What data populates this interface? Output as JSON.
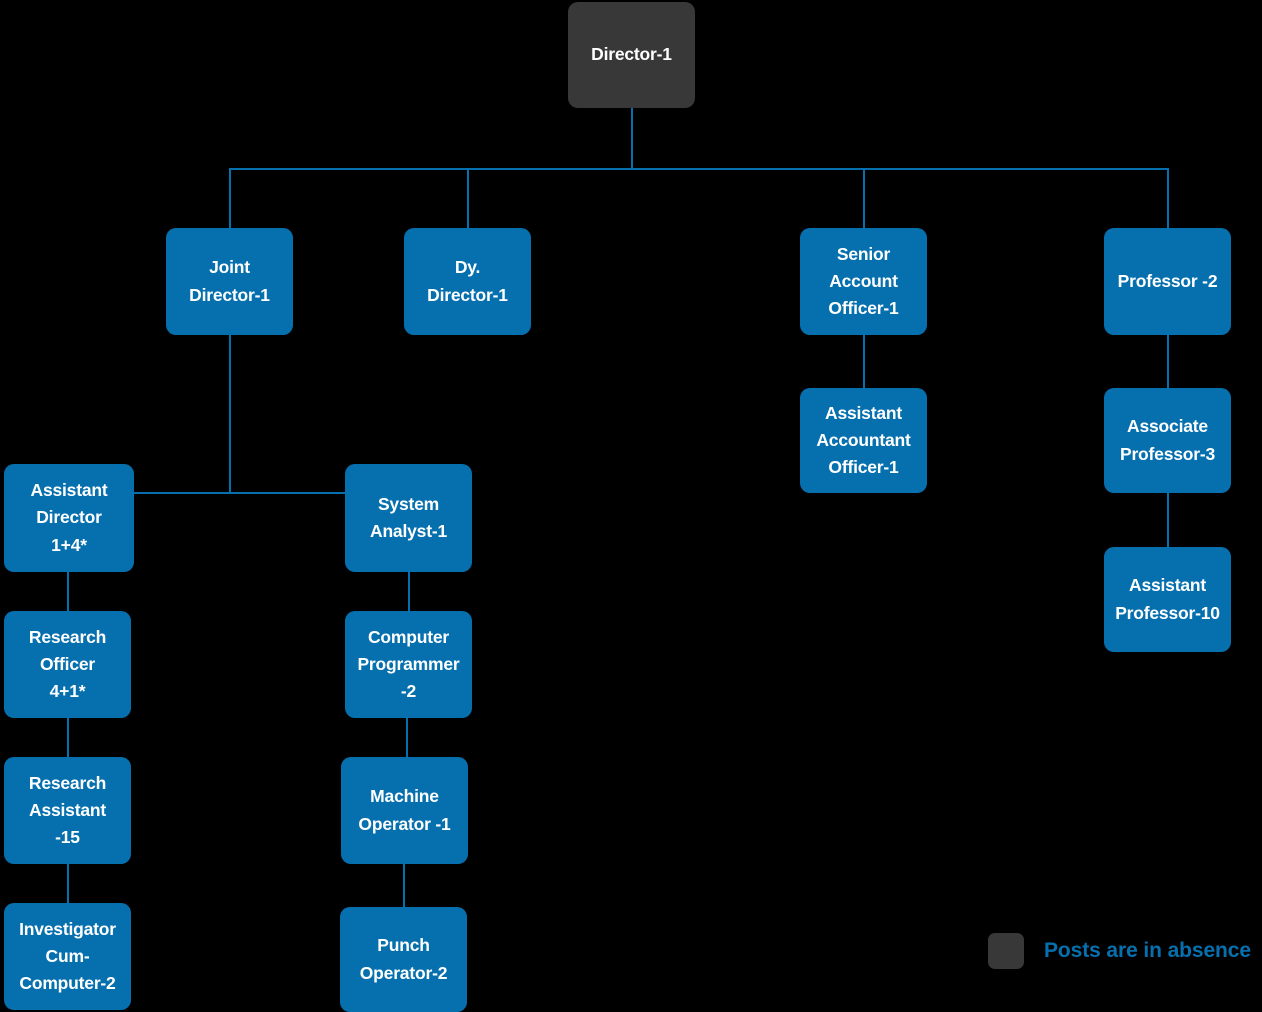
{
  "chart_data": {
    "type": "diagram",
    "title": "Organizational Structure Chart",
    "diagram_kind": "org-chart",
    "colors": {
      "background": "#000000",
      "node_fill": "#0670AF",
      "absent_node_fill": "#383838",
      "node_text": "#ffffff",
      "connector": "#0670AF",
      "legend_text": "#0670AF"
    },
    "nodes": [
      {
        "id": "director",
        "label": "Director-1",
        "count": 1,
        "style": "absent",
        "parent": null,
        "level": 0
      },
      {
        "id": "joint-director",
        "label": "Joint\nDirector-1",
        "count": 1,
        "style": "normal",
        "parent": "director",
        "level": 1
      },
      {
        "id": "dy-director",
        "label": "Dy.\nDirector-1",
        "count": 1,
        "style": "normal",
        "parent": "director",
        "level": 1
      },
      {
        "id": "senior-account-officer",
        "label": "Senior\nAccount\nOfficer-1",
        "count": 1,
        "style": "normal",
        "parent": "director",
        "level": 1
      },
      {
        "id": "professor",
        "label": "Professor -2",
        "count": 2,
        "style": "normal",
        "parent": "director",
        "level": 1
      },
      {
        "id": "assistant-accountant-officer",
        "label": "Assistant\nAccountant\nOfficer-1",
        "count": 1,
        "style": "normal",
        "parent": "senior-account-officer",
        "level": 2
      },
      {
        "id": "associate-professor",
        "label": "Associate\nProfessor-3",
        "count": 3,
        "style": "normal",
        "parent": "professor",
        "level": 2
      },
      {
        "id": "assistant-professor",
        "label": "Assistant\nProfessor-10",
        "count": 10,
        "style": "normal",
        "parent": "associate-professor",
        "level": 3
      },
      {
        "id": "assistant-director",
        "label": "Assistant\nDirector\n1+4*",
        "count": "1+4*",
        "style": "normal",
        "parent": "joint-director",
        "level": 2
      },
      {
        "id": "system-analyst",
        "label": "System\nAnalyst-1",
        "count": 1,
        "style": "normal",
        "parent": "joint-director",
        "level": 2
      },
      {
        "id": "research-officer",
        "label": "Research\nOfficer\n4+1*",
        "count": "4+1*",
        "style": "normal",
        "parent": "assistant-director",
        "level": 3
      },
      {
        "id": "research-assistant",
        "label": "Research\nAssistant\n-15",
        "count": 15,
        "style": "normal",
        "parent": "research-officer",
        "level": 4
      },
      {
        "id": "investigator-cum-computer",
        "label": "Investigator\nCum-\nComputer-2",
        "count": 2,
        "style": "normal",
        "parent": "research-assistant",
        "level": 5
      },
      {
        "id": "computer-programmer",
        "label": "Computer\nProgrammer\n-2",
        "count": 2,
        "style": "normal",
        "parent": "system-analyst",
        "level": 3
      },
      {
        "id": "machine-operator",
        "label": "Machine\nOperator -1",
        "count": 1,
        "style": "normal",
        "parent": "computer-programmer",
        "level": 4
      },
      {
        "id": "punch-operator",
        "label": "Punch\nOperator-2",
        "count": 2,
        "style": "normal",
        "parent": "machine-operator",
        "level": 5
      }
    ],
    "legend": {
      "swatch_color": "#383838",
      "text": "Posts are in absence"
    }
  },
  "nodes": {
    "director": "Director-1",
    "joint_director": "Joint\nDirector-1",
    "dy_director": "Dy.\nDirector-1",
    "senior_account_officer": "Senior\nAccount\nOfficer-1",
    "professor": "Professor -2",
    "assistant_accountant_officer": "Assistant\nAccountant\nOfficer-1",
    "associate_professor": "Associate\nProfessor-3",
    "assistant_professor": "Assistant\nProfessor-10",
    "assistant_director": "Assistant\nDirector\n1+4*",
    "system_analyst": "System\nAnalyst-1",
    "research_officer": "Research\nOfficer\n4+1*",
    "research_assistant": "Research\nAssistant\n-15",
    "investigator_cum_computer": "Investigator\nCum-\nComputer-2",
    "computer_programmer": "Computer\nProgrammer\n-2",
    "machine_operator": "Machine\nOperator -1",
    "punch_operator": "Punch\nOperator-2"
  },
  "legend": {
    "text": "Posts are in absence"
  }
}
